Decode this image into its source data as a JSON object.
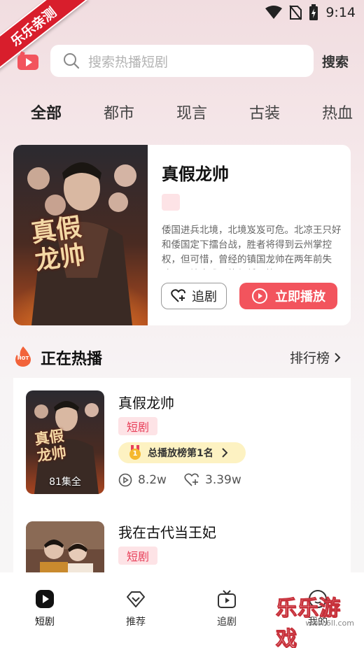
{
  "status_bar": {
    "time": "9:14"
  },
  "ribbon": {
    "text": "乐乐亲测"
  },
  "header": {
    "search_placeholder": "搜索热播短剧",
    "search_button": "搜索"
  },
  "tabs": [
    "全部",
    "都市",
    "现言",
    "古装",
    "热血"
  ],
  "featured": {
    "title": "真假龙帅",
    "poster_text": "真假龙帅",
    "description": "倭国进兵北境，北境岌岌可危。北凉王只好和倭国定下擂台战，胜者将得到云州掌控权，但可惜，曾经的镇国龙帅在两年前失踪，而境内唯一能与倭国抗...",
    "follow_label": "追剧",
    "play_label": "立即播放"
  },
  "section": {
    "hot_badge": "HOT",
    "title": "正在热播",
    "ranking_label": "排行榜"
  },
  "list": [
    {
      "title": "真假龙帅",
      "poster_text": "真假龙帅",
      "tag": "短剧",
      "episodes": "81集全",
      "rank_label": "总播放榜第1名",
      "rank_number": "1",
      "plays": "8.2w",
      "likes": "3.39w"
    },
    {
      "title": "我在古代当王妃",
      "tag": "短剧"
    }
  ],
  "bottom_nav": [
    {
      "label": "短剧",
      "icon": "play-icon"
    },
    {
      "label": "推荐",
      "icon": "diamond-icon"
    },
    {
      "label": "追剧",
      "icon": "tv-icon"
    },
    {
      "label": "我的",
      "icon": "face-icon"
    }
  ],
  "watermark": {
    "text": "乐乐游戏",
    "url_text": "www.6ll.com"
  },
  "colors": {
    "accent": "#f2545d",
    "tag_bg": "#fde3e6",
    "tag_text": "#e8405a",
    "ribbon": "#d81e2c",
    "rank_badge_bg": "#fdf2c2"
  }
}
